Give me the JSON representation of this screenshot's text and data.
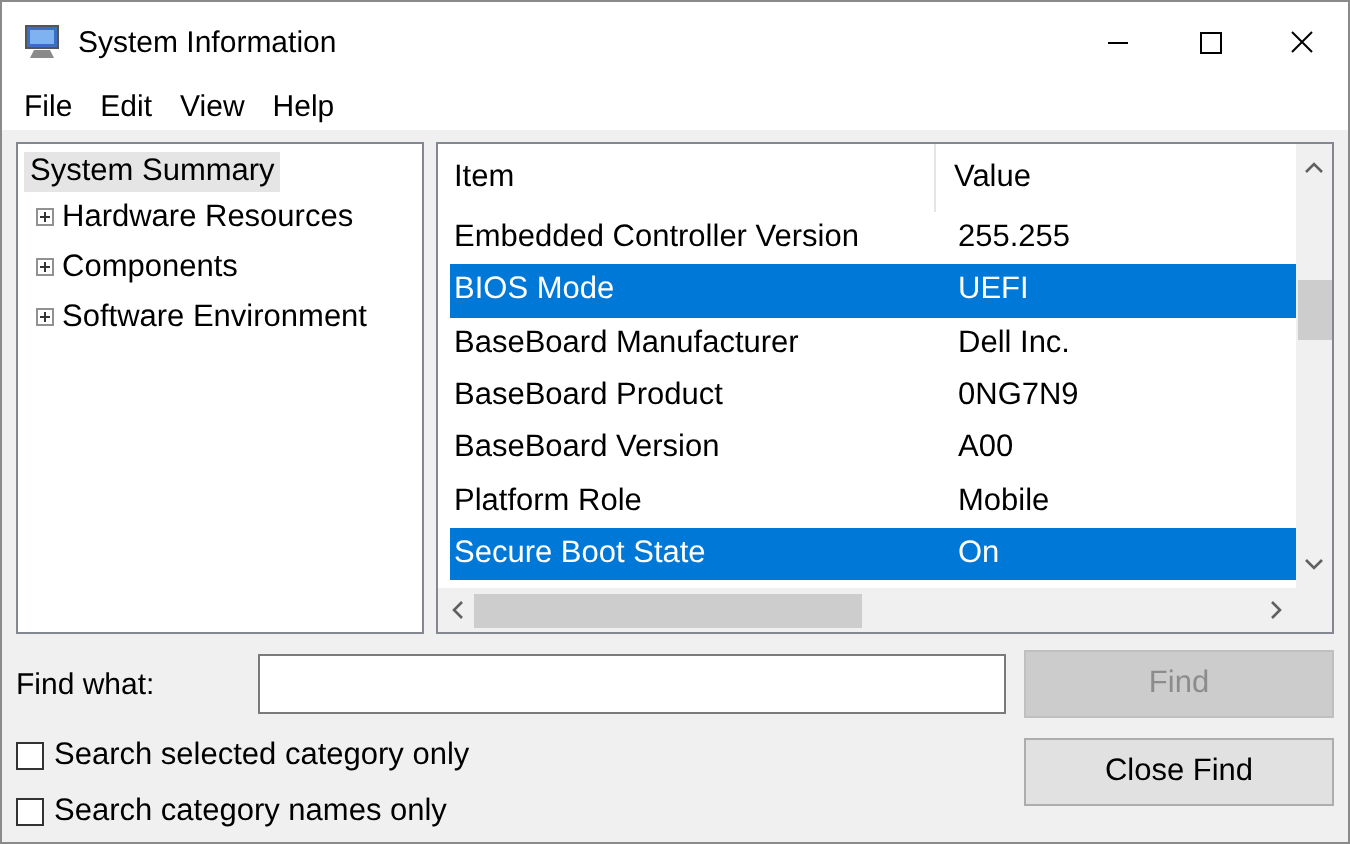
{
  "window": {
    "title": "System Information"
  },
  "menu": [
    {
      "label": "File"
    },
    {
      "label": "Edit"
    },
    {
      "label": "View"
    },
    {
      "label": "Help"
    }
  ],
  "tree": {
    "label": "System Summary",
    "selected": true,
    "children": [
      {
        "label": "Hardware Resources",
        "expanded": false,
        "selected": false
      },
      {
        "label": "Components",
        "expanded": false,
        "selected": false
      },
      {
        "label": "Software Environment",
        "expanded": false,
        "selected": false
      }
    ]
  },
  "table": {
    "columns": [
      "Item",
      "Value"
    ],
    "rows": [
      {
        "item": "Embedded Controller Version",
        "value": "255.255",
        "selected": false
      },
      {
        "item": "BIOS Mode",
        "value": "UEFI",
        "selected": true
      },
      {
        "item": "BaseBoard Manufacturer",
        "value": "Dell Inc.",
        "selected": false
      },
      {
        "item": "BaseBoard Product",
        "value": "0NG7N9",
        "selected": false
      },
      {
        "item": "BaseBoard Version",
        "value": "A00",
        "selected": false
      },
      {
        "item": "Platform Role",
        "value": "Mobile",
        "selected": false
      },
      {
        "item": "Secure Boot State",
        "value": "On",
        "selected": true
      }
    ]
  },
  "find": {
    "label": "Find what:",
    "options": [
      {
        "label": "Search selected category only",
        "checked": false
      },
      {
        "label": "Search category names only",
        "checked": false
      }
    ],
    "buttons": [
      {
        "label": "Find",
        "disabled": true
      },
      {
        "label": "Close Find",
        "disabled": false
      }
    ]
  }
}
